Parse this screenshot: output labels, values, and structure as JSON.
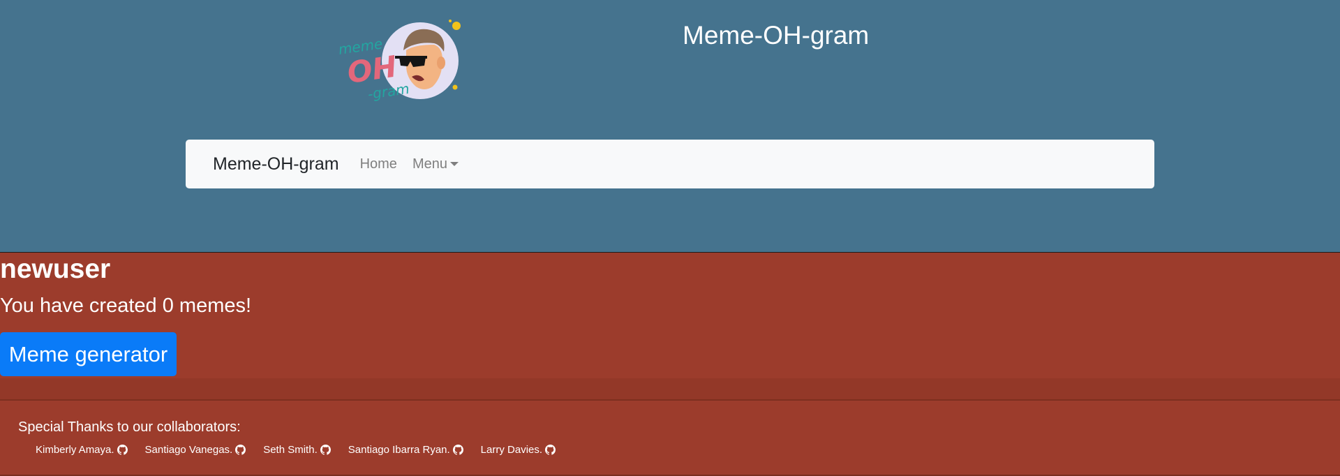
{
  "header": {
    "site_title": "Meme-OH-gram",
    "logo": {
      "icon": "meme-oh-gram-logo",
      "text_top": "meme",
      "text_middle": "OH",
      "text_bottom": "-gram"
    }
  },
  "navbar": {
    "brand": "Meme-OH-gram",
    "home": "Home",
    "menu": "Menu"
  },
  "profile": {
    "username": "newuser",
    "memes_created": "You have created 0 memes!",
    "generator_button": "Meme generator"
  },
  "footer": {
    "thanks": "Special Thanks to our collaborators:",
    "collaborators": [
      {
        "name": "Kimberly Amaya.",
        "icon": "github-icon"
      },
      {
        "name": "Santiago Vanegas.",
        "icon": "github-icon"
      },
      {
        "name": "Seth Smith.",
        "icon": "github-icon"
      },
      {
        "name": "Santiago Ibarra Ryan.",
        "icon": "github-icon"
      },
      {
        "name": "Larry Davies.",
        "icon": "github-icon"
      }
    ]
  },
  "colors": {
    "header_bg": "#45738e",
    "body_bg": "#9c3c2c",
    "navbar_bg": "#f8f9fa",
    "button_bg": "#0a7bf8"
  }
}
